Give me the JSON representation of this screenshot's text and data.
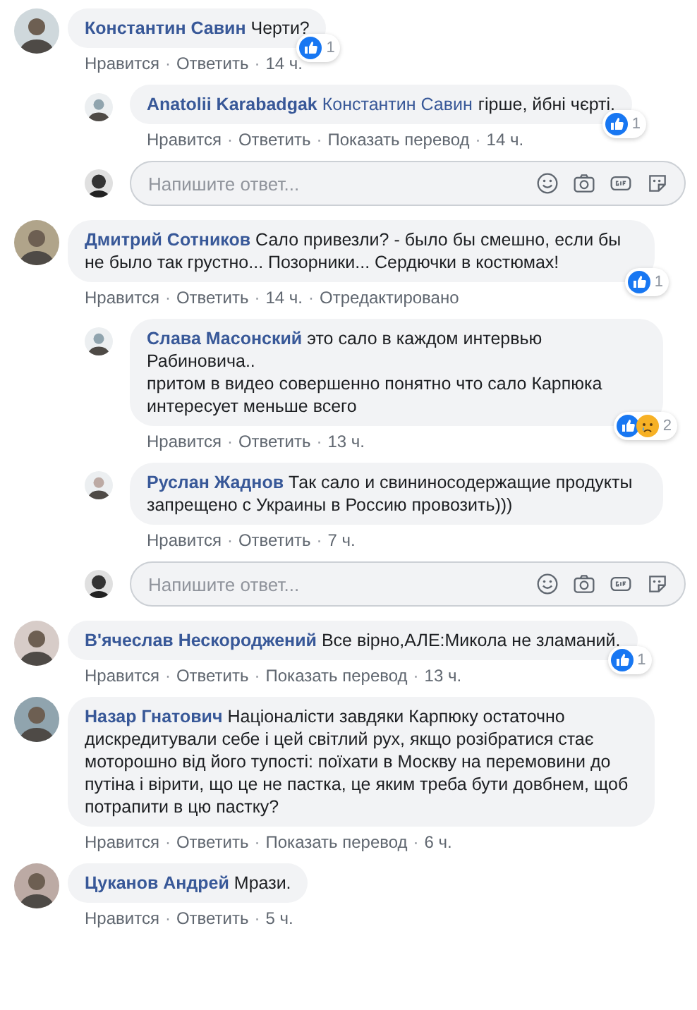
{
  "threads": [
    {
      "author": "Константин Савин",
      "text": "Черти?",
      "reactions": {
        "icons": [
          {
            "kind": "like"
          }
        ],
        "count": "1"
      },
      "actions": [
        {
          "kind": "link",
          "label": "Нравится"
        },
        {
          "kind": "separator",
          "label": "·"
        },
        {
          "kind": "link",
          "label": "Ответить"
        },
        {
          "kind": "separator",
          "label": "·"
        },
        {
          "kind": "time",
          "label": "14 ч."
        }
      ],
      "replies": [
        {
          "author": "Anatolii Karabadgak",
          "mention": "Константин Савин",
          "text": "гірше, йбні чєрті.",
          "reactions": {
            "icons": [
              {
                "kind": "like"
              }
            ],
            "count": "1"
          },
          "actions": [
            {
              "kind": "link",
              "label": "Нравится"
            },
            {
              "kind": "separator",
              "label": "·"
            },
            {
              "kind": "link",
              "label": "Ответить"
            },
            {
              "kind": "separator",
              "label": "·"
            },
            {
              "kind": "link",
              "label": "Показать перевод"
            },
            {
              "kind": "separator",
              "label": "·"
            },
            {
              "kind": "time",
              "label": "14 ч."
            }
          ]
        }
      ],
      "reply_box": {
        "placeholder": "Напишите ответ..."
      }
    },
    {
      "author": "Дмитрий Сотников",
      "text": "Сало привезли? - было бы смешно, если бы не было так грустно... Позорники... Сердючки в костюмах!",
      "reactions": {
        "icons": [
          {
            "kind": "like"
          }
        ],
        "count": "1"
      },
      "actions": [
        {
          "kind": "link",
          "label": "Нравится"
        },
        {
          "kind": "separator",
          "label": "·"
        },
        {
          "kind": "link",
          "label": "Ответить"
        },
        {
          "kind": "separator",
          "label": "·"
        },
        {
          "kind": "time",
          "label": "14 ч."
        },
        {
          "kind": "separator",
          "label": "·"
        },
        {
          "kind": "note",
          "label": "Отредактировано"
        }
      ],
      "replies": [
        {
          "author": "Слава Масонский",
          "text": "это сало в каждом интервью Рабиновича..\nпритом в видео совершенно понятно что сало Карпюка интересует меньше всего",
          "reactions": {
            "icons": [
              {
                "kind": "like"
              },
              {
                "kind": "sad"
              }
            ],
            "count": "2"
          },
          "actions": [
            {
              "kind": "link",
              "label": "Нравится"
            },
            {
              "kind": "separator",
              "label": "·"
            },
            {
              "kind": "link",
              "label": "Ответить"
            },
            {
              "kind": "separator",
              "label": "·"
            },
            {
              "kind": "time",
              "label": "13 ч."
            }
          ]
        },
        {
          "author": "Руслан Жаднов",
          "text": "Так сало и свининосодержащие продукты запрещено с Украины в Россию провозить)))",
          "actions": [
            {
              "kind": "link",
              "label": "Нравится"
            },
            {
              "kind": "separator",
              "label": "·"
            },
            {
              "kind": "link",
              "label": "Ответить"
            },
            {
              "kind": "separator",
              "label": "·"
            },
            {
              "kind": "time",
              "label": "7 ч."
            }
          ]
        }
      ],
      "reply_box": {
        "placeholder": "Напишите ответ..."
      }
    },
    {
      "author": "В'ячеслав Нескороджений",
      "text": "Все вірно,АЛЕ:Микола не зламаний.",
      "reactions": {
        "icons": [
          {
            "kind": "like"
          }
        ],
        "count": "1"
      },
      "actions": [
        {
          "kind": "link",
          "label": "Нравится"
        },
        {
          "kind": "separator",
          "label": "·"
        },
        {
          "kind": "link",
          "label": "Ответить"
        },
        {
          "kind": "separator",
          "label": "·"
        },
        {
          "kind": "link",
          "label": "Показать перевод"
        },
        {
          "kind": "separator",
          "label": "·"
        },
        {
          "kind": "time",
          "label": "13 ч."
        }
      ]
    },
    {
      "author": "Назар Гнатович",
      "text": "Націоналісти завдяки Карпюку остаточно дискредитували себе і цей світлий рух, якщо розібратися стає моторошно від його тупості: поїхати в Москву на перемовини до путіна і вірити, що це не пастка, це яким треба бути довбнем, щоб потрапити в цю пастку?",
      "actions": [
        {
          "kind": "link",
          "label": "Нравится"
        },
        {
          "kind": "separator",
          "label": "·"
        },
        {
          "kind": "link",
          "label": "Ответить"
        },
        {
          "kind": "separator",
          "label": "·"
        },
        {
          "kind": "link",
          "label": "Показать перевод"
        },
        {
          "kind": "separator",
          "label": "·"
        },
        {
          "kind": "time",
          "label": "6 ч."
        }
      ]
    },
    {
      "author": "Цуканов Андрей",
      "text": "Мрази.",
      "actions": [
        {
          "kind": "link",
          "label": "Нравится"
        },
        {
          "kind": "separator",
          "label": "·"
        },
        {
          "kind": "link",
          "label": "Ответить"
        },
        {
          "kind": "separator",
          "label": "·"
        },
        {
          "kind": "time",
          "label": "5 ч."
        }
      ]
    }
  ]
}
